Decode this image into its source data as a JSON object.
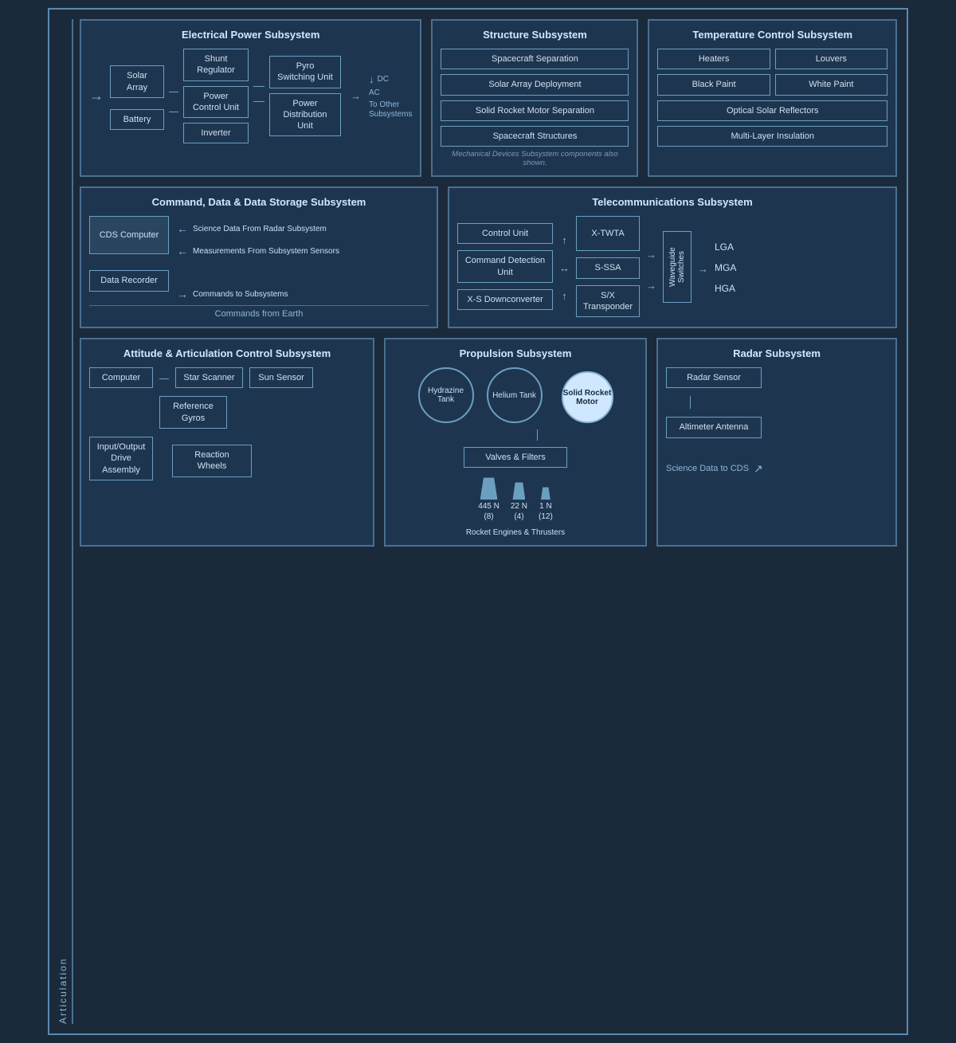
{
  "sections": {
    "eps": {
      "title": "Electrical Power Subsystem",
      "components": {
        "solar_array": "Solar Array",
        "battery": "Battery",
        "shunt_regulator": "Shunt Regulator",
        "power_control_unit": "Power Control Unit",
        "inverter": "Inverter",
        "pyro_switching": "Pyro Switching Unit",
        "power_distribution": "Power Distribution Unit",
        "ac_label": "AC",
        "dc_label": "DC",
        "to_other": "To Other Subsystems"
      }
    },
    "structure": {
      "title": "Structure Subsystem",
      "components": [
        "Spacecraft Separation",
        "Solar Array Deployment",
        "Solid Rocket Motor Separation",
        "Spacecraft Structures"
      ],
      "note": "Mechanical Devices Subsystem components also shown."
    },
    "temp": {
      "title": "Temperature Control Subsystem",
      "components": {
        "heaters": "Heaters",
        "louvers": "Louvers",
        "black_paint": "Black Paint",
        "white_paint": "White Paint",
        "optical_reflectors": "Optical Solar Reflectors",
        "multi_layer": "Multi-Layer Insulation"
      }
    },
    "cds": {
      "title": "Command, Data & Data Storage Subsystem",
      "components": {
        "cds_computer": "CDS Computer",
        "data_recorder": "Data Recorder",
        "science_data": "Science Data From Radar Subsystem",
        "measurements": "Measurements From Subsystem Sensors",
        "commands_to": "Commands to Subsystems",
        "commands_from": "Commands from Earth"
      }
    },
    "telecom": {
      "title": "Telecommunications Subsystem",
      "components": {
        "control_unit": "Control Unit",
        "command_detection": "Command Detection Unit",
        "x_twta": "X-TWTA",
        "xs_downconverter": "X-S Downconverter",
        "waveguide": "Waveguide Switches",
        "s_ssa": "S-SSA",
        "sx_transponder": "S/X Transponder",
        "lga": "LGA",
        "mga": "MGA",
        "hga": "HGA"
      }
    },
    "aacs": {
      "title": "Attitude & Articulation Control Subsystem",
      "components": {
        "computer": "Computer",
        "star_scanner": "Star Scanner",
        "sun_sensor": "Sun Sensor",
        "reference_gyros": "Reference Gyros",
        "input_output": "Input/Output Drive Assembly",
        "reaction_wheels": "Reaction Wheels"
      }
    },
    "propulsion": {
      "title": "Propulsion Subsystem",
      "components": {
        "hydrazine": "Hydrazine Tank",
        "helium": "Helium Tank",
        "valves_filters": "Valves & Filters",
        "solid_rocket": "Solid Rocket Motor",
        "engine_445": "445 N\n(8)",
        "engine_22": "22 N\n(4)",
        "engine_1": "1 N\n(12)",
        "rocket_label": "Rocket Engines & Thrusters"
      }
    },
    "radar": {
      "title": "Radar Subsystem",
      "components": {
        "radar_sensor": "Radar Sensor",
        "altimeter_antenna": "Altimeter Antenna",
        "science_data_to": "Science Data to CDS"
      }
    }
  },
  "articulation_label": "Articulation"
}
